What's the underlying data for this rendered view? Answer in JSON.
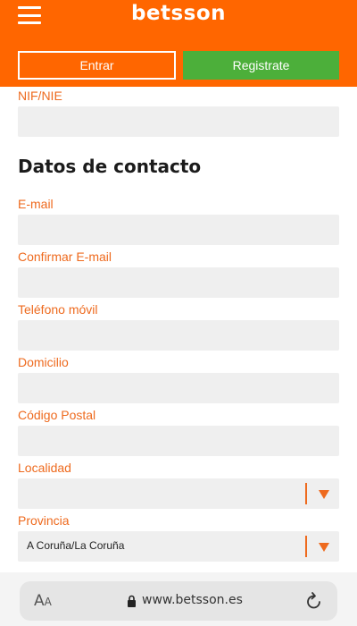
{
  "header": {
    "logo": "betsson",
    "login_label": "Entrar",
    "register_label": "Registrate"
  },
  "form": {
    "nif_label": "NIF/NIE",
    "section_title": "Datos de contacto",
    "email_label": "E-mail",
    "confirm_email_label": "Confirmar E-mail",
    "phone_label": "Teléfono móvil",
    "address_label": "Domicilio",
    "postal_label": "Código Postal",
    "locality_label": "Localidad",
    "locality_value": "",
    "province_label": "Provincia",
    "province_value": "A Coruña/La Coruña"
  },
  "browser": {
    "text_size_label": "A",
    "text_size_label_small": "A",
    "url": "www.betsson.es"
  },
  "colors": {
    "brand_orange": "#ff6600",
    "label_orange": "#ee6a1e",
    "register_green": "#4caf3a",
    "field_gray": "#efefef"
  },
  "icons": [
    "menu-icon",
    "dropdown-arrow-icon",
    "lock-icon",
    "reload-icon"
  ]
}
